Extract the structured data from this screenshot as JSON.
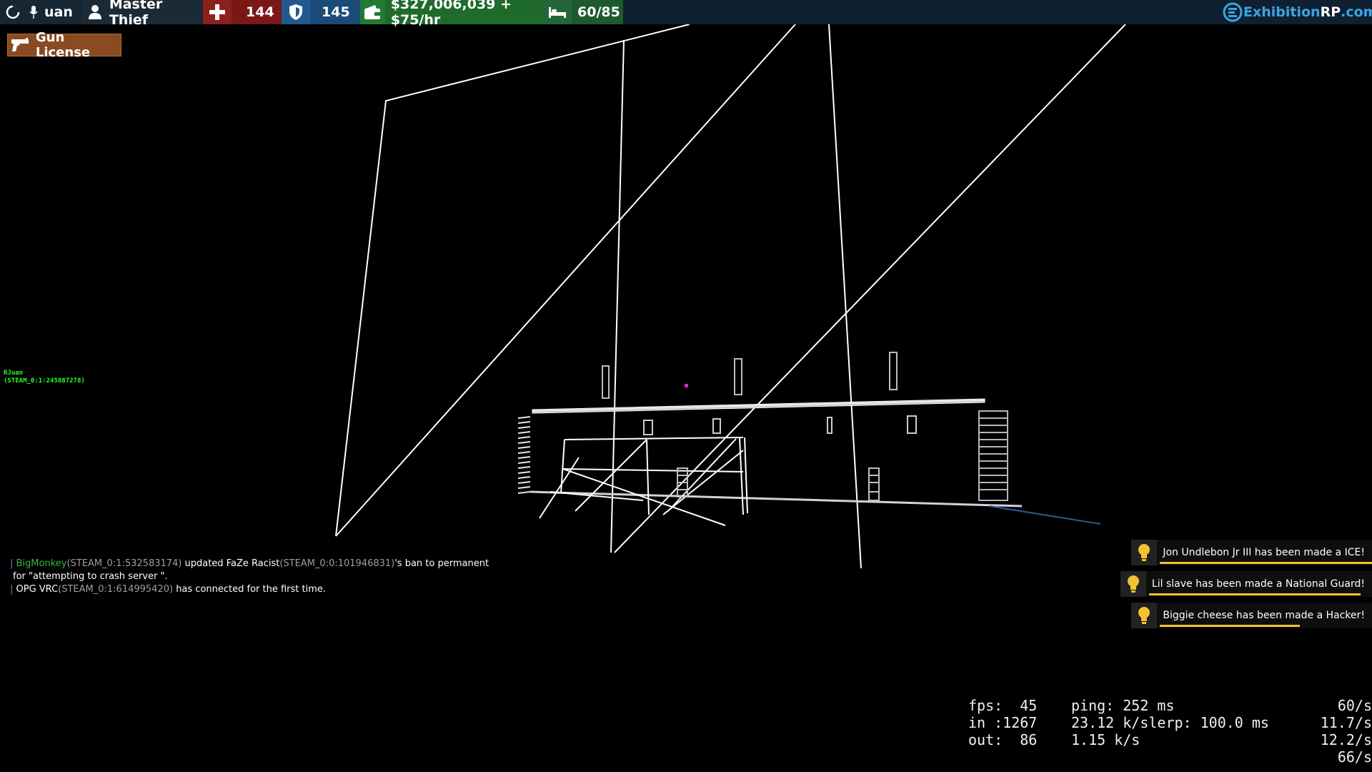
{
  "hud": {
    "player_name": "uan",
    "job": "Master Thief",
    "health": "144",
    "armor": "145",
    "money": "$327,006,039 + $75/hr",
    "hunger": "60/85",
    "brand_main": "Exhibition",
    "brand_rp": "RP",
    "brand_tld": ".com",
    "colors": {
      "bar_bg": "#1f2d3a",
      "health": "#7a1818",
      "armor": "#1b4b78",
      "money": "#1e6b2c",
      "brand": "#3aa5e6"
    },
    "icons": [
      "loading-icon",
      "microphone-icon",
      "user-icon",
      "health-cross-icon",
      "shield-icon",
      "wallet-icon",
      "bed-icon",
      "exhibition-logo-icon"
    ]
  },
  "license": {
    "label": "Gun License",
    "icon": "pistol-icon",
    "color": "#8a4a22"
  },
  "player_tag": {
    "name": "RJuan",
    "steam_id": "(STEAM_0:1:245887278)",
    "color": "#29ff29"
  },
  "chat": {
    "line1": {
      "admin": "BigMonkey",
      "admin_id": "(STEAM_0:1:532583174)",
      "action": " updated FaZe Racist",
      "target_id": "(STEAM_0:0:101946831)",
      "tail": "'s ban to permanent"
    },
    "line1_cont": "for \"attempting to crash server \".",
    "line2": {
      "player": "OPG VRC",
      "player_id": "(STEAM_0:1:614995420)",
      "action": " has connected for the first time."
    }
  },
  "notifications": [
    {
      "icon": "lightbulb-icon",
      "text": "Jon Undlebon Jr III has been made a ICE!",
      "progress": 1.0
    },
    {
      "icon": "lightbulb-icon",
      "text": "Lil slave has been made a National Guard!",
      "progress": 0.95
    },
    {
      "icon": "lightbulb-icon",
      "text": "Biggie cheese has been made a Hacker!",
      "progress": 0.7
    }
  ],
  "netgraph": {
    "r1c1": "fps:  45",
    "r1c2": "ping: 252 ms",
    "r1c3": "60/s",
    "r2c1": "in :1267",
    "r2c2": "23.12 k/slerp: 100.0 ms",
    "r2c3": "11.7/s",
    "r3c1": "out:  86",
    "r3c2": "1.15 k/s",
    "r3c3": "12.2/s",
    "r4c3": "66/s"
  }
}
